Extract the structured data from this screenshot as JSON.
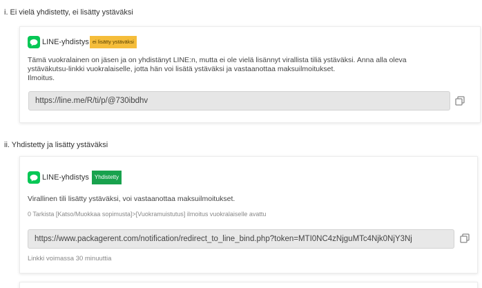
{
  "section1": {
    "title": "i. Ei vielä yhdistetty, ei lisätty ystäväksi",
    "label": "LINE-yhdistys",
    "badge": "ei lisätty ystäväksi",
    "description_line1": "Tämä vuokralainen on jäsen ja on yhdistänyt LINE:n, mutta ei ole vielä lisännyt virallista tiliä ystäväksi. Anna alla oleva",
    "description_line2": "ystäväkutsu-linkki vuokralaiselle, jotta hän voi lisätä ystäväksi ja vastaanottaa maksuilmoitukset.",
    "description_line3": "Ilmoitus.",
    "url": "https://line.me/R/ti/p/@730ibdhv"
  },
  "section2": {
    "title": "ii. Yhdistetty ja lisätty ystäväksi",
    "label": "LINE-yhdistys",
    "badge": "Yhdistetty",
    "description": "Virallinen tili lisätty ystäväksi, voi vastaanottaa maksuilmoitukset.",
    "meta": "0 Tarkista [Katso/Muokkaa sopimusta]>[Vuokramuistutus] ilmoitus vuokralaiselle avattu",
    "url": "https://www.packagerent.com/notification/redirect_to_line_bind.php?token=MTI0NC4zNjguMTc4Njk0NjY3Nj",
    "validity": "Linkki voimassa 30 minuuttia"
  },
  "colors": {
    "line_green": "#06c755",
    "warn_badge": "#f5bd3a",
    "ok_badge": "#18a24d"
  },
  "icons": {
    "logo": "line-logo-icon",
    "copy": "copy-icon"
  }
}
